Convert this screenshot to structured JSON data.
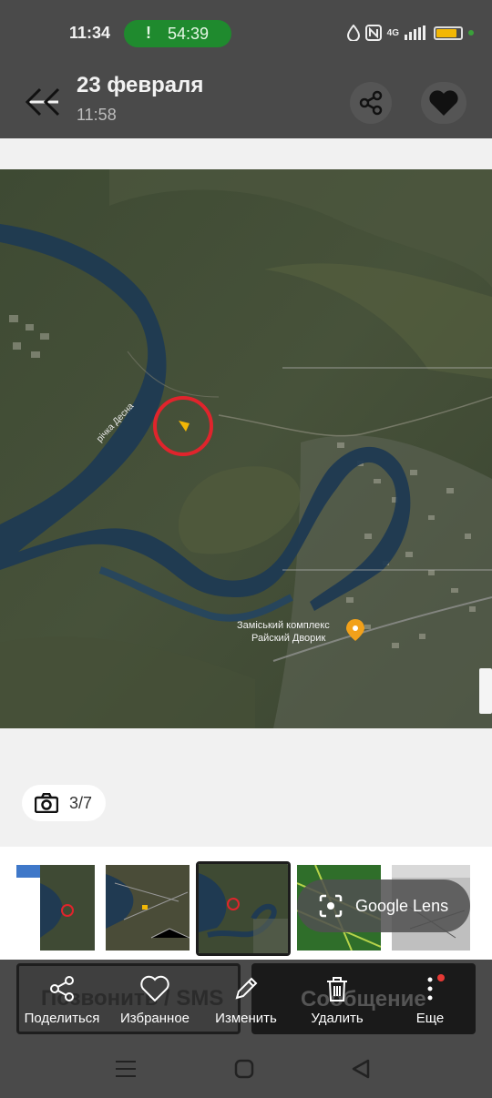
{
  "status_bar": {
    "time": "11:34",
    "call_timer": "54:39",
    "network": "4G"
  },
  "header": {
    "title": "23 февраля",
    "subtitle": "11:58"
  },
  "map": {
    "river_label": "річка Десна",
    "place_label_line1": "Заміський комплекс",
    "place_label_line2": "Райский Дворик"
  },
  "photo_counter": "3/7",
  "google_lens": "Google Lens",
  "background_buttons": {
    "call_sms": "Позвонить / SMS",
    "message": "Сообщение"
  },
  "actions": [
    {
      "label": "Поделиться",
      "icon": "share-icon"
    },
    {
      "label": "Избранное",
      "icon": "heart-outline-icon"
    },
    {
      "label": "Изменить",
      "icon": "pencil-icon"
    },
    {
      "label": "Удалить",
      "icon": "trash-icon"
    },
    {
      "label": "Еще",
      "icon": "more-vertical-icon"
    }
  ],
  "colors": {
    "bar_bg": "#4a4a4a",
    "call_pill": "#1f8a2e",
    "battery": "#f2b705",
    "marker_circle": "#e0242c",
    "notification_dot": "#e53935"
  }
}
